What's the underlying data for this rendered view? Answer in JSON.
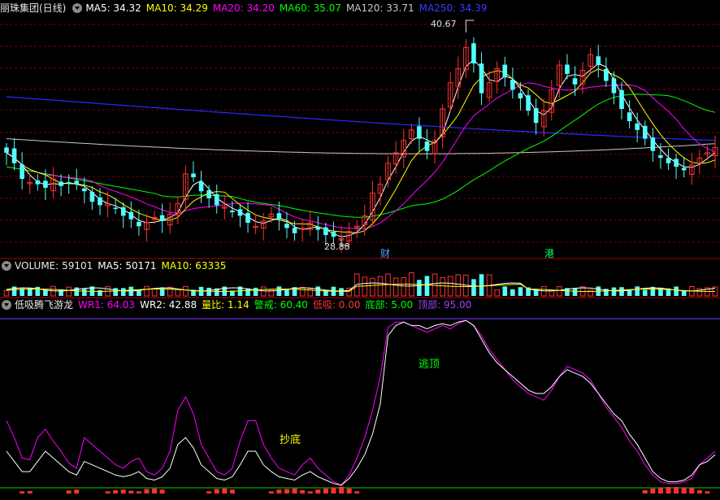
{
  "colors": {
    "bg": "#000000",
    "up": "#ff3232",
    "down": "#54ffff",
    "ma5": "#ffffff",
    "ma10": "#ffff00",
    "ma20": "#ff00ff",
    "ma60": "#00ff00",
    "ma120": "#c8c8c8",
    "ma250": "#2a2aff",
    "grid": "#7a0000",
    "sep": "#b00000"
  },
  "header_main": {
    "title": "丽珠集团(日线)",
    "ma5": "MA5: 34.32",
    "ma10": "MA10: 34.29",
    "ma20": "MA20: 34.20",
    "ma60": "MA60: 35.07",
    "ma120": "MA120: 33.71",
    "ma250": "MA250: 34.39"
  },
  "header_vol": {
    "label": "VOLUME: 59101",
    "ma5": "MA5: 50171",
    "ma10": "MA10: 63335"
  },
  "header_ind": {
    "title": "低吸腾飞游龙",
    "wr1": "WR1: 64.03",
    "wr2": "WR2: 42.88",
    "lb": "量比: 1.14",
    "jj": "警戒: 60.40",
    "dx": "低吸: 0.00",
    "db": "底部: 5.00",
    "dingbu": "顶部: 95.00"
  },
  "annotations": {
    "high": "40.67",
    "low": "28.88",
    "cai": "财",
    "gang": "港",
    "chaodi": "抄底",
    "taoding": "逃顶"
  },
  "chart_data": [
    {
      "type": "candlestick",
      "panel": "price",
      "y_range_approx": [
        28.5,
        41.5
      ],
      "high_label": 40.67,
      "low_label": 28.88,
      "closes_approx": [
        33.8,
        33.2,
        32.3,
        32.1,
        32.0,
        31.8,
        32.3,
        31.9,
        32.1,
        32.0,
        31.6,
        31.0,
        30.8,
        30.9,
        30.6,
        30.2,
        30.0,
        29.6,
        29.8,
        30.1,
        29.9,
        30.3,
        30.9,
        32.6,
        32.4,
        31.6,
        31.2,
        30.8,
        30.7,
        30.4,
        30.2,
        29.8,
        29.6,
        29.9,
        30.3,
        30.0,
        29.5,
        29.2,
        29.5,
        29.8,
        29.4,
        29.1,
        29.0,
        28.9,
        29.3,
        29.6,
        30.2,
        31.5,
        32.0,
        33.2,
        33.8,
        34.5,
        35.1,
        34.6,
        33.9,
        34.5,
        36.3,
        37.8,
        38.6,
        39.8,
        38.9,
        37.2,
        37.8,
        38.6,
        38.1,
        37.4,
        36.9,
        36.2,
        35.5,
        36.2,
        37.4,
        38.8,
        38.3,
        37.7,
        38.5,
        39.4,
        38.8,
        37.9,
        37.2,
        36.3,
        35.6,
        35.1,
        34.6,
        33.9,
        33.5,
        33.2,
        33.0,
        32.8,
        33.1,
        33.5,
        33.8,
        34.1
      ],
      "moving_averages": [
        "MA5",
        "MA10",
        "MA20",
        "MA60",
        "MA120",
        "MA250"
      ]
    },
    {
      "type": "bar",
      "panel": "volume",
      "series": [
        {
          "name": "VOLUME",
          "latest": 59101
        },
        {
          "name": "MA5",
          "latest": 50171
        },
        {
          "name": "MA10",
          "latest": 63335
        }
      ]
    },
    {
      "type": "line",
      "panel": "indicator",
      "y_range": [
        0,
        100
      ],
      "series": [
        {
          "name": "WR1",
          "latest": 64.03,
          "values": [
            40,
            30,
            18,
            17,
            30,
            35,
            28,
            22,
            15,
            12,
            30,
            26,
            22,
            18,
            14,
            12,
            16,
            18,
            10,
            8,
            12,
            22,
            46,
            54,
            44,
            26,
            18,
            10,
            8,
            12,
            28,
            40,
            40,
            26,
            18,
            12,
            10,
            8,
            14,
            18,
            12,
            8,
            4,
            2,
            8,
            18,
            30,
            46,
            66,
            95,
            98,
            98,
            96,
            94,
            92,
            94,
            96,
            94,
            97,
            99,
            96,
            90,
            82,
            76,
            70,
            64,
            60,
            56,
            54,
            52,
            58,
            66,
            72,
            70,
            68,
            64,
            56,
            48,
            42,
            36,
            28,
            22,
            14,
            8,
            4,
            3,
            3,
            4,
            6,
            14,
            18,
            22
          ]
        },
        {
          "name": "WR2",
          "latest": 42.88,
          "values": [
            22,
            16,
            10,
            10,
            16,
            22,
            18,
            14,
            10,
            8,
            16,
            14,
            12,
            10,
            8,
            7,
            8,
            10,
            6,
            5,
            7,
            12,
            26,
            30,
            24,
            14,
            10,
            6,
            5,
            7,
            14,
            22,
            22,
            14,
            10,
            7,
            6,
            5,
            8,
            10,
            7,
            5,
            3,
            2,
            6,
            12,
            20,
            32,
            50,
            90,
            96,
            98,
            96,
            96,
            94,
            96,
            97,
            96,
            98,
            99,
            96,
            88,
            80,
            74,
            70,
            66,
            62,
            58,
            56,
            56,
            60,
            66,
            70,
            68,
            66,
            62,
            56,
            50,
            44,
            40,
            32,
            26,
            18,
            10,
            6,
            4,
            4,
            5,
            8,
            14,
            16,
            20
          ]
        }
      ],
      "reference_levels": [
        {
          "name": "底部",
          "value": 5.0
        },
        {
          "name": "顶部",
          "value": 95.0
        },
        {
          "name": "警戒",
          "value": 60.4
        },
        {
          "name": "低吸",
          "value": 0.0
        }
      ]
    }
  ]
}
